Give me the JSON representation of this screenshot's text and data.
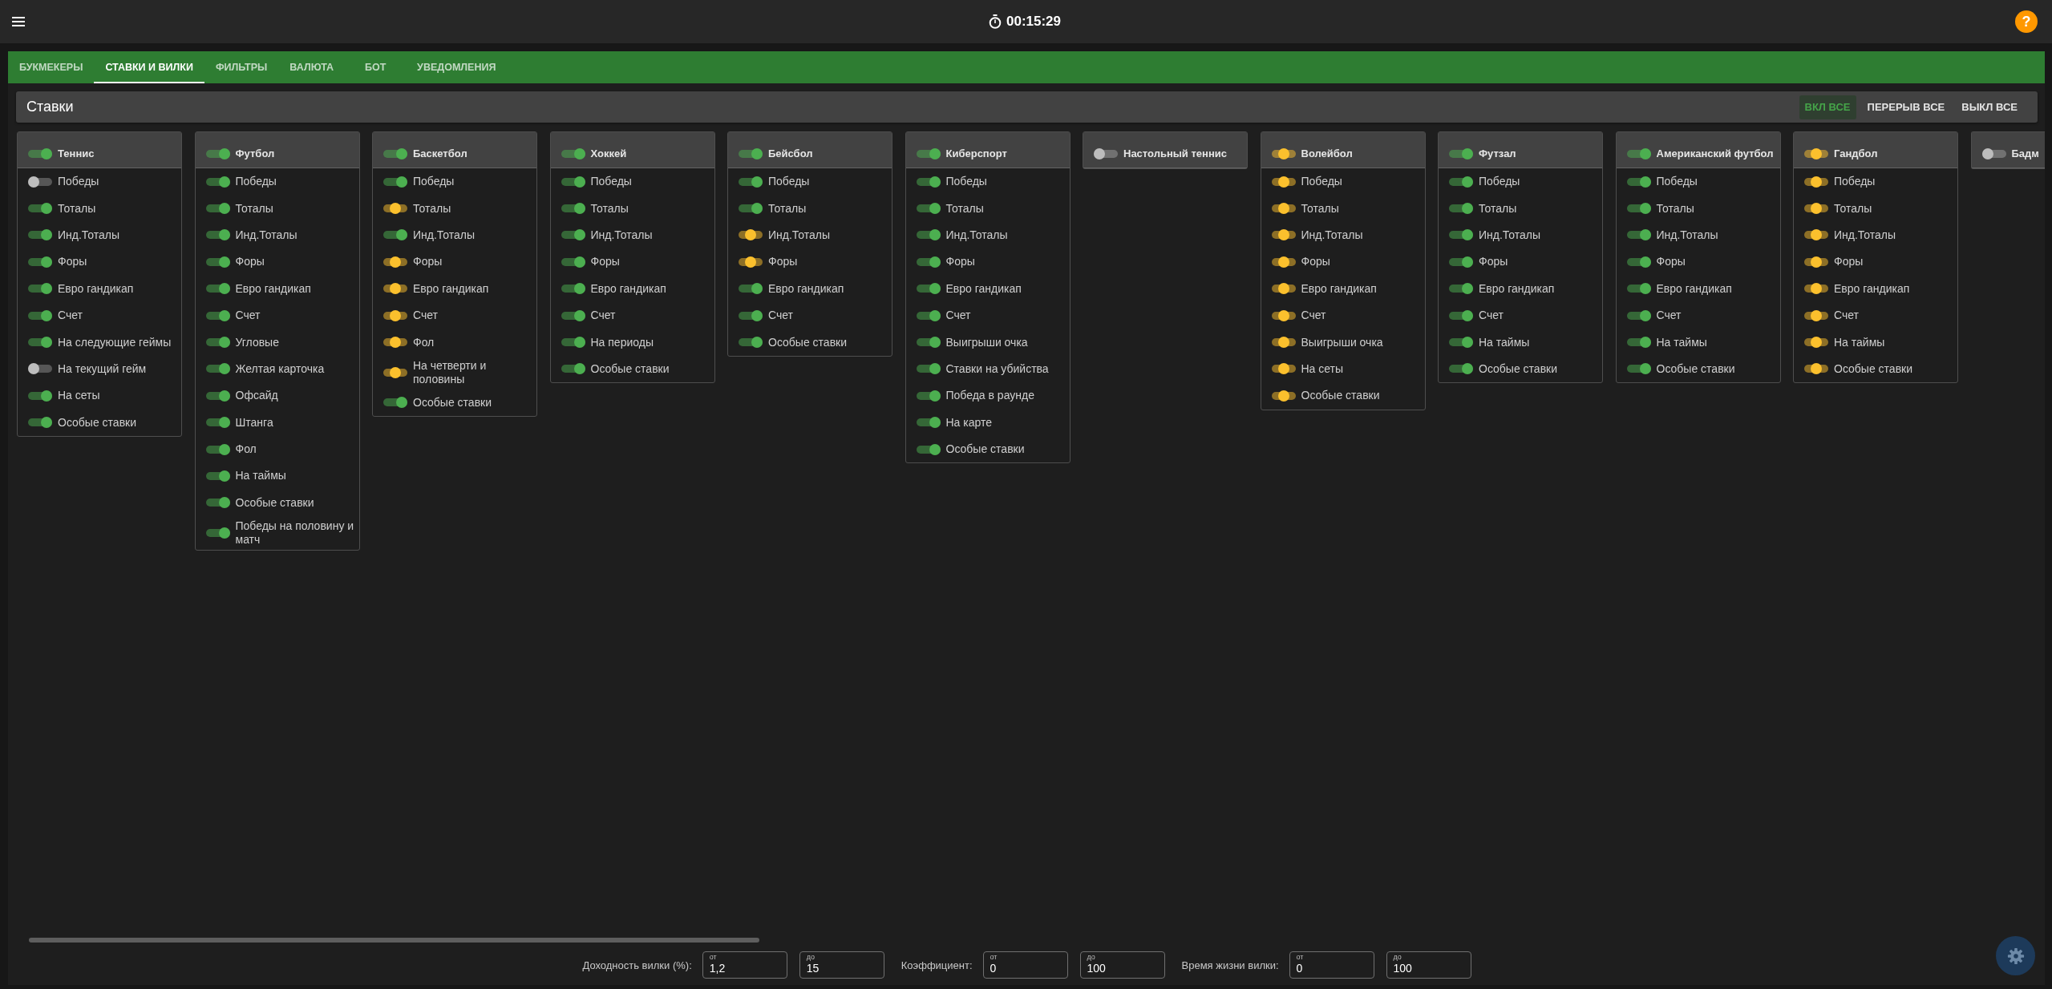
{
  "header": {
    "timer": "00:15:29",
    "help": "?"
  },
  "tabs": [
    {
      "label": "БУКМЕКЕРЫ",
      "selected": false
    },
    {
      "label": "СТАВКИ И ВИЛКИ",
      "selected": true
    },
    {
      "label": "ФИЛЬТРЫ",
      "selected": false
    },
    {
      "label": "ВАЛЮТА",
      "selected": false
    },
    {
      "label": "БОТ",
      "selected": false
    },
    {
      "label": "УВЕДОМЛЕНИЯ",
      "selected": false
    }
  ],
  "section": {
    "title": "Ставки",
    "buttons": [
      {
        "label": "ВКЛ ВСЕ",
        "selected": true
      },
      {
        "label": "ПЕРЕРЫВ ВСЕ",
        "selected": false
      },
      {
        "label": "ВЫКЛ ВСЕ",
        "selected": false
      }
    ]
  },
  "cards": [
    {
      "title": "Теннис",
      "kind": "on",
      "items": [
        {
          "label": "Победы",
          "kind": "off"
        },
        {
          "label": "Тоталы",
          "kind": "on"
        },
        {
          "label": "Инд.Тоталы",
          "kind": "on"
        },
        {
          "label": "Форы",
          "kind": "on"
        },
        {
          "label": "Евро гандикап",
          "kind": "on"
        },
        {
          "label": "Счет",
          "kind": "on"
        },
        {
          "label": "На следующие геймы",
          "kind": "on"
        },
        {
          "label": "На текущий гейм",
          "kind": "off"
        },
        {
          "label": "На сеты",
          "kind": "on"
        },
        {
          "label": "Особые ставки",
          "kind": "on"
        }
      ]
    },
    {
      "title": "Футбол",
      "kind": "on",
      "items": [
        {
          "label": "Победы",
          "kind": "on"
        },
        {
          "label": "Тоталы",
          "kind": "on"
        },
        {
          "label": "Инд.Тоталы",
          "kind": "on"
        },
        {
          "label": "Форы",
          "kind": "on"
        },
        {
          "label": "Евро гандикап",
          "kind": "on"
        },
        {
          "label": "Счет",
          "kind": "on"
        },
        {
          "label": "Угловые",
          "kind": "on"
        },
        {
          "label": "Желтая карточка",
          "kind": "on"
        },
        {
          "label": "Офсайд",
          "kind": "on"
        },
        {
          "label": "Штанга",
          "kind": "on"
        },
        {
          "label": "Фол",
          "kind": "on"
        },
        {
          "label": "На таймы",
          "kind": "on"
        },
        {
          "label": "Особые ставки",
          "kind": "on"
        },
        {
          "label": "Победы на половину и матч",
          "kind": "on"
        }
      ]
    },
    {
      "title": "Баскетбол",
      "kind": "on",
      "items": [
        {
          "label": "Победы",
          "kind": "on"
        },
        {
          "label": "Тоталы",
          "kind": "pause"
        },
        {
          "label": "Инд.Тоталы",
          "kind": "on"
        },
        {
          "label": "Форы",
          "kind": "pause"
        },
        {
          "label": "Евро гандикап",
          "kind": "pause"
        },
        {
          "label": "Счет",
          "kind": "pause"
        },
        {
          "label": "Фол",
          "kind": "pause"
        },
        {
          "label": "На четверти и половины",
          "kind": "pause"
        },
        {
          "label": "Особые ставки",
          "kind": "on"
        }
      ]
    },
    {
      "title": "Хоккей",
      "kind": "on",
      "items": [
        {
          "label": "Победы",
          "kind": "on"
        },
        {
          "label": "Тоталы",
          "kind": "on"
        },
        {
          "label": "Инд.Тоталы",
          "kind": "on"
        },
        {
          "label": "Форы",
          "kind": "on"
        },
        {
          "label": "Евро гандикап",
          "kind": "on"
        },
        {
          "label": "Счет",
          "kind": "on"
        },
        {
          "label": "На периоды",
          "kind": "on"
        },
        {
          "label": "Особые ставки",
          "kind": "on"
        }
      ]
    },
    {
      "title": "Бейсбол",
      "kind": "on",
      "items": [
        {
          "label": "Победы",
          "kind": "on"
        },
        {
          "label": "Тоталы",
          "kind": "on"
        },
        {
          "label": "Инд.Тоталы",
          "kind": "pause"
        },
        {
          "label": "Форы",
          "kind": "pause"
        },
        {
          "label": "Евро гандикап",
          "kind": "on"
        },
        {
          "label": "Счет",
          "kind": "on"
        },
        {
          "label": "Особые ставки",
          "kind": "on"
        }
      ]
    },
    {
      "title": "Киберспорт",
      "kind": "on",
      "items": [
        {
          "label": "Победы",
          "kind": "on"
        },
        {
          "label": "Тоталы",
          "kind": "on"
        },
        {
          "label": "Инд.Тоталы",
          "kind": "on"
        },
        {
          "label": "Форы",
          "kind": "on"
        },
        {
          "label": "Евро гандикап",
          "kind": "on"
        },
        {
          "label": "Счет",
          "kind": "on"
        },
        {
          "label": "Выигрыши очка",
          "kind": "on"
        },
        {
          "label": "Ставки на убийства",
          "kind": "on"
        },
        {
          "label": "Победа в раунде",
          "kind": "on"
        },
        {
          "label": "На карте",
          "kind": "on"
        },
        {
          "label": "Особые ставки",
          "kind": "on"
        }
      ]
    },
    {
      "title": "Настольный теннис",
      "kind": "off"
    },
    {
      "title": "Волейбол",
      "kind": "pause",
      "items": [
        {
          "label": "Победы",
          "kind": "pause"
        },
        {
          "label": "Тоталы",
          "kind": "pause"
        },
        {
          "label": "Инд.Тоталы",
          "kind": "pause"
        },
        {
          "label": "Форы",
          "kind": "pause"
        },
        {
          "label": "Евро гандикап",
          "kind": "pause"
        },
        {
          "label": "Счет",
          "kind": "pause"
        },
        {
          "label": "Выигрыши очка",
          "kind": "pause"
        },
        {
          "label": "На сеты",
          "kind": "pause"
        },
        {
          "label": "Особые ставки",
          "kind": "pause"
        }
      ]
    },
    {
      "title": "Футзал",
      "kind": "on",
      "items": [
        {
          "label": "Победы",
          "kind": "on"
        },
        {
          "label": "Тоталы",
          "kind": "on"
        },
        {
          "label": "Инд.Тоталы",
          "kind": "on"
        },
        {
          "label": "Форы",
          "kind": "on"
        },
        {
          "label": "Евро гандикап",
          "kind": "on"
        },
        {
          "label": "Счет",
          "kind": "on"
        },
        {
          "label": "На таймы",
          "kind": "on"
        },
        {
          "label": "Особые ставки",
          "kind": "on"
        }
      ]
    },
    {
      "title": "Американский футбол",
      "kind": "on",
      "items": [
        {
          "label": "Победы",
          "kind": "on"
        },
        {
          "label": "Тоталы",
          "kind": "on"
        },
        {
          "label": "Инд.Тоталы",
          "kind": "on"
        },
        {
          "label": "Форы",
          "kind": "on"
        },
        {
          "label": "Евро гандикап",
          "kind": "on"
        },
        {
          "label": "Счет",
          "kind": "on"
        },
        {
          "label": "На таймы",
          "kind": "on"
        },
        {
          "label": "Особые ставки",
          "kind": "on"
        }
      ]
    },
    {
      "title": "Гандбол",
      "kind": "pause",
      "items": [
        {
          "label": "Победы",
          "kind": "pause"
        },
        {
          "label": "Тоталы",
          "kind": "pause"
        },
        {
          "label": "Инд.Тоталы",
          "kind": "pause"
        },
        {
          "label": "Форы",
          "kind": "pause"
        },
        {
          "label": "Евро гандикап",
          "kind": "pause"
        },
        {
          "label": "Счет",
          "kind": "pause"
        },
        {
          "label": "На таймы",
          "kind": "pause"
        },
        {
          "label": "Особые ставки",
          "kind": "pause"
        }
      ]
    },
    {
      "title": "Бадм",
      "kind": "off"
    }
  ],
  "filters": [
    {
      "label": "Доходность вилки (%):",
      "fields": [
        {
          "label": "от",
          "value": "1,2"
        },
        {
          "label": "до",
          "value": "15"
        }
      ]
    },
    {
      "label": "Коэффициент:",
      "fields": [
        {
          "label": "от",
          "value": "0"
        },
        {
          "label": "до",
          "value": "100"
        }
      ]
    },
    {
      "label": "Время жизни вилки:",
      "fields": [
        {
          "label": "от",
          "value": "0"
        },
        {
          "label": "до",
          "value": "100"
        }
      ]
    }
  ]
}
